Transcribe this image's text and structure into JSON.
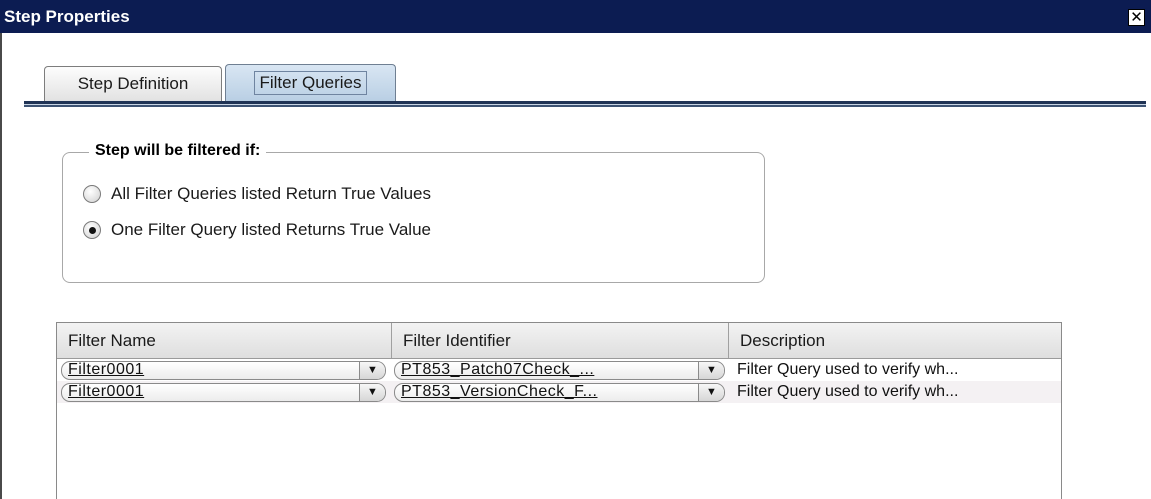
{
  "window": {
    "title": "Step Properties",
    "close_label": "✕"
  },
  "tabs": [
    {
      "label": "Step Definition",
      "active": false
    },
    {
      "label": "Filter Queries",
      "active": true
    }
  ],
  "filter_group": {
    "legend": "Step will be filtered if:",
    "options": [
      {
        "label": "All Filter Queries listed Return True Values",
        "checked": false
      },
      {
        "label": "One Filter Query listed Returns True Value",
        "checked": true
      }
    ]
  },
  "grid": {
    "columns": [
      "Filter Name",
      "Filter Identifier",
      "Description"
    ],
    "rows": [
      {
        "filter_name": "Filter0001",
        "filter_identifier": "PT853_Patch07Check_...",
        "description": "Filter Query used to verify wh..."
      },
      {
        "filter_name": "Filter0001",
        "filter_identifier": "PT853_VersionCheck_F...",
        "description": "Filter Query used to verify wh..."
      }
    ],
    "dropdown_icon": "▼"
  }
}
